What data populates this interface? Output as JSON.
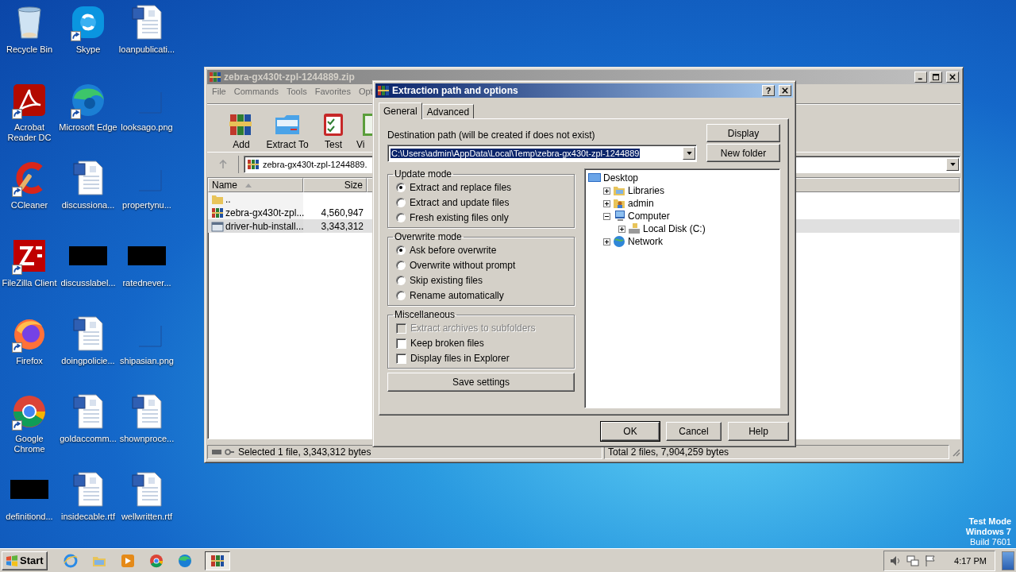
{
  "desktop_icons": [
    {
      "label": "Recycle Bin",
      "kind": "recycle",
      "shortcut": false
    },
    {
      "label": "Acrobat Reader DC",
      "kind": "acrobat",
      "shortcut": true
    },
    {
      "label": "CCleaner",
      "kind": "ccleaner",
      "shortcut": true
    },
    {
      "label": "FileZilla Client",
      "kind": "filezilla",
      "shortcut": true
    },
    {
      "label": "Firefox",
      "kind": "firefox",
      "shortcut": true
    },
    {
      "label": "Google Chrome",
      "kind": "chrome",
      "shortcut": true
    },
    {
      "label": "definitiond...",
      "kind": "thumbnail",
      "shortcut": false
    },
    {
      "label": "Skype",
      "kind": "skype",
      "shortcut": true
    },
    {
      "label": "Microsoft Edge",
      "kind": "edge",
      "shortcut": true
    },
    {
      "label": "discussiona...",
      "kind": "word",
      "shortcut": false
    },
    {
      "label": "discusslabel...",
      "kind": "thumbnail",
      "shortcut": false
    },
    {
      "label": "doingpolicie...",
      "kind": "word",
      "shortcut": false
    },
    {
      "label": "goldaccomm...",
      "kind": "word",
      "shortcut": false
    },
    {
      "label": "insidecable.rtf",
      "kind": "word",
      "shortcut": false
    },
    {
      "label": "loanpublicati...",
      "kind": "word",
      "shortcut": false
    },
    {
      "label": "looksago.png",
      "kind": "image",
      "shortcut": false
    },
    {
      "label": "propertynu...",
      "kind": "image",
      "shortcut": false
    },
    {
      "label": "ratednever...",
      "kind": "thumbnail",
      "shortcut": false
    },
    {
      "label": "shipasian.png",
      "kind": "image",
      "shortcut": false
    },
    {
      "label": "shownproce...",
      "kind": "word",
      "shortcut": false
    },
    {
      "label": "wellwritten.rtf",
      "kind": "word",
      "shortcut": false
    }
  ],
  "archive_window": {
    "title": "zebra-gx430t-zpl-1244889.zip",
    "menu": [
      "File",
      "Commands",
      "Tools",
      "Favorites",
      "Opt"
    ],
    "toolbar": [
      {
        "label": "Add",
        "kind": "add"
      },
      {
        "label": "Extract To",
        "kind": "extract"
      },
      {
        "label": "Test",
        "kind": "test"
      },
      {
        "label": "Vi",
        "kind": "view"
      }
    ],
    "address": "zebra-gx430t-zpl-1244889.",
    "columns": [
      "Name",
      "Size"
    ],
    "rows": [
      {
        "name": "..",
        "kind": "folder",
        "selected": false
      },
      {
        "name": "zebra-gx430t-zpl...",
        "size": "4,560,947",
        "kind": "archive",
        "selected": false
      },
      {
        "name": "driver-hub-install...",
        "size": "3,343,312",
        "kind": "program",
        "selected": true
      }
    ],
    "status_left": "Selected 1 file, 3,343,312 bytes",
    "status_right": "Total 2 files, 7,904,259 bytes"
  },
  "dialog": {
    "title": "Extraction path and options",
    "help_button": "?",
    "tabs": [
      {
        "label": "General",
        "selected": true
      },
      {
        "label": "Advanced",
        "selected": false
      }
    ],
    "destination_label": "Destination path (will be created if does not exist)",
    "destination_path": "C:\\Users\\admin\\AppData\\Local\\Temp\\zebra-gx430t-zpl-1244889",
    "path_selected": true,
    "side_buttons": [
      "Display",
      "New folder"
    ],
    "update_mode": {
      "title": "Update mode",
      "options": [
        {
          "label": "Extract and replace files",
          "selected": true
        },
        {
          "label": "Extract and update files",
          "selected": false
        },
        {
          "label": "Fresh existing files only",
          "selected": false
        }
      ]
    },
    "overwrite_mode": {
      "title": "Overwrite mode",
      "options": [
        {
          "label": "Ask before overwrite",
          "selected": true
        },
        {
          "label": "Overwrite without prompt",
          "selected": false
        },
        {
          "label": "Skip existing files",
          "selected": false
        },
        {
          "label": "Rename automatically",
          "selected": false
        }
      ]
    },
    "miscellaneous": {
      "title": "Miscellaneous",
      "options": [
        {
          "label": "Extract archives to subfolders",
          "checked": false,
          "disabled": true
        },
        {
          "label": "Keep broken files",
          "checked": false,
          "disabled": false
        },
        {
          "label": "Display files in Explorer",
          "checked": false,
          "disabled": false
        }
      ]
    },
    "save_button": "Save settings",
    "folder_tree": [
      {
        "label": "Desktop",
        "kind": "desktop",
        "children": [
          {
            "label": "Libraries",
            "kind": "libraries",
            "expanded": false
          },
          {
            "label": "admin",
            "kind": "user",
            "expanded": false
          },
          {
            "label": "Computer",
            "kind": "computer",
            "expanded": true,
            "children": [
              {
                "label": "Local Disk (C:)",
                "kind": "drive",
                "expanded": false
              }
            ]
          },
          {
            "label": "Network",
            "kind": "network",
            "expanded": false
          }
        ]
      }
    ],
    "buttons": [
      {
        "label": "OK",
        "default": true
      },
      {
        "label": "Cancel",
        "default": false
      },
      {
        "label": "Help",
        "default": false
      }
    ]
  },
  "os_watermark": [
    "Test Mode",
    "Windows 7",
    "Build 7601"
  ],
  "taskbar": {
    "start": "Start",
    "apps": [
      {
        "kind": "ie",
        "active": false
      },
      {
        "kind": "explorer",
        "active": false
      },
      {
        "kind": "media",
        "active": false
      },
      {
        "kind": "chrome",
        "active": false
      },
      {
        "kind": "edge",
        "active": false
      },
      {
        "kind": "winrar",
        "active": true
      }
    ],
    "clock": "4:17 PM"
  }
}
